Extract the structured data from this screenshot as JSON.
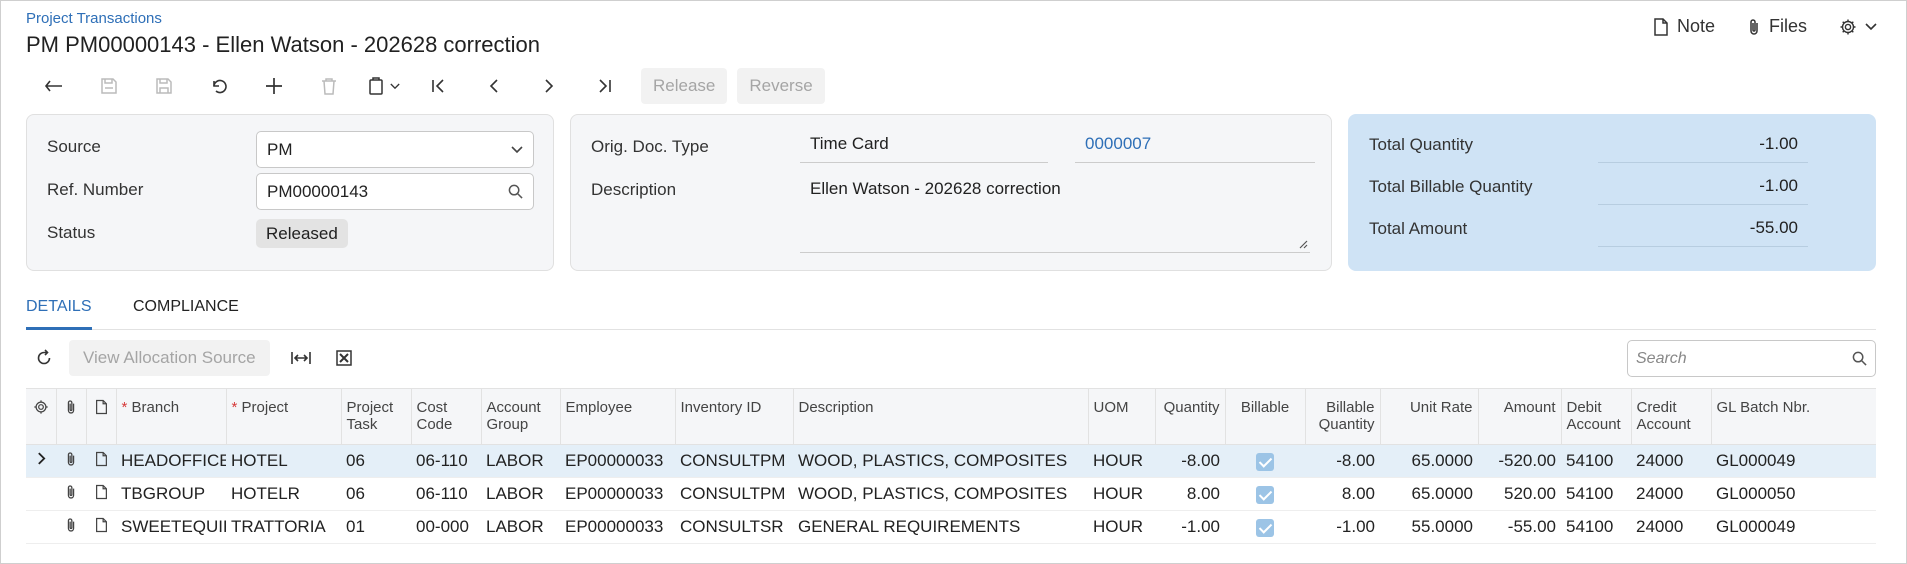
{
  "breadcrumb": "Project Transactions",
  "title": "PM PM00000143 - Ellen Watson - 202628 correction",
  "topright": {
    "note": "Note",
    "files": "Files"
  },
  "toolbar": {
    "release": "Release",
    "reverse": "Reverse"
  },
  "summary": {
    "source_label": "Source",
    "source_value": "PM",
    "ref_label": "Ref. Number",
    "ref_value": "PM00000143",
    "status_label": "Status",
    "status_value": "Released",
    "orig_doc_label": "Orig. Doc. Type",
    "orig_doc_type": "Time Card",
    "orig_doc_nbr": "0000007",
    "desc_label": "Description",
    "desc_value": "Ellen Watson - 202628 correction",
    "total_qty_label": "Total Quantity",
    "total_qty": "-1.00",
    "total_bill_qty_label": "Total Billable Quantity",
    "total_bill_qty": "-1.00",
    "total_amount_label": "Total Amount",
    "total_amount": "-55.00"
  },
  "tabs": {
    "details": "DETAILS",
    "compliance": "COMPLIANCE"
  },
  "grid_toolbar": {
    "view_alloc": "View Allocation Source",
    "search_placeholder": "Search"
  },
  "columns": {
    "branch": "Branch",
    "project": "Project",
    "project_task": [
      "Project",
      "Task"
    ],
    "cost_code": [
      "Cost",
      "Code"
    ],
    "account_group": [
      "Account",
      "Group"
    ],
    "employee": "Employee",
    "inventory_id": "Inventory ID",
    "description": "Description",
    "uom": "UOM",
    "quantity": "Quantity",
    "billable": "Billable",
    "billable_qty": [
      "Billable",
      "Quantity"
    ],
    "unit_rate": "Unit Rate",
    "amount": "Amount",
    "debit_account": [
      "Debit",
      "Account"
    ],
    "credit_account": [
      "Credit",
      "Account"
    ],
    "gl_batch": "GL Batch Nbr."
  },
  "rows": [
    {
      "branch": "HEADOFFICE",
      "project": "HOTEL",
      "task": "06",
      "cost_code": "06-110",
      "account_group": "LABOR",
      "employee": "EP00000033",
      "inventory_id": "CONSULTPM",
      "description": "WOOD, PLASTICS, COMPOSITES",
      "uom": "HOUR",
      "quantity": "-8.00",
      "billable_qty": "-8.00",
      "unit_rate": "65.0000",
      "amount": "-520.00",
      "debit": "54100",
      "credit": "24000",
      "gl_batch": "GL000049"
    },
    {
      "branch": "TBGROUP",
      "project": "HOTELR",
      "task": "06",
      "cost_code": "06-110",
      "account_group": "LABOR",
      "employee": "EP00000033",
      "inventory_id": "CONSULTPM",
      "description": "WOOD, PLASTICS, COMPOSITES",
      "uom": "HOUR",
      "quantity": "8.00",
      "billable_qty": "8.00",
      "unit_rate": "65.0000",
      "amount": "520.00",
      "debit": "54100",
      "credit": "24000",
      "gl_batch": "GL000050"
    },
    {
      "branch": "SWEETEQUIP",
      "project": "TRATTORIA",
      "task": "01",
      "cost_code": "00-000",
      "account_group": "LABOR",
      "employee": "EP00000033",
      "inventory_id": "CONSULTSR",
      "description": "GENERAL REQUIREMENTS",
      "uom": "HOUR",
      "quantity": "-1.00",
      "billable_qty": "-1.00",
      "unit_rate": "55.0000",
      "amount": "-55.00",
      "debit": "54100",
      "credit": "24000",
      "gl_batch": "GL000049"
    }
  ]
}
